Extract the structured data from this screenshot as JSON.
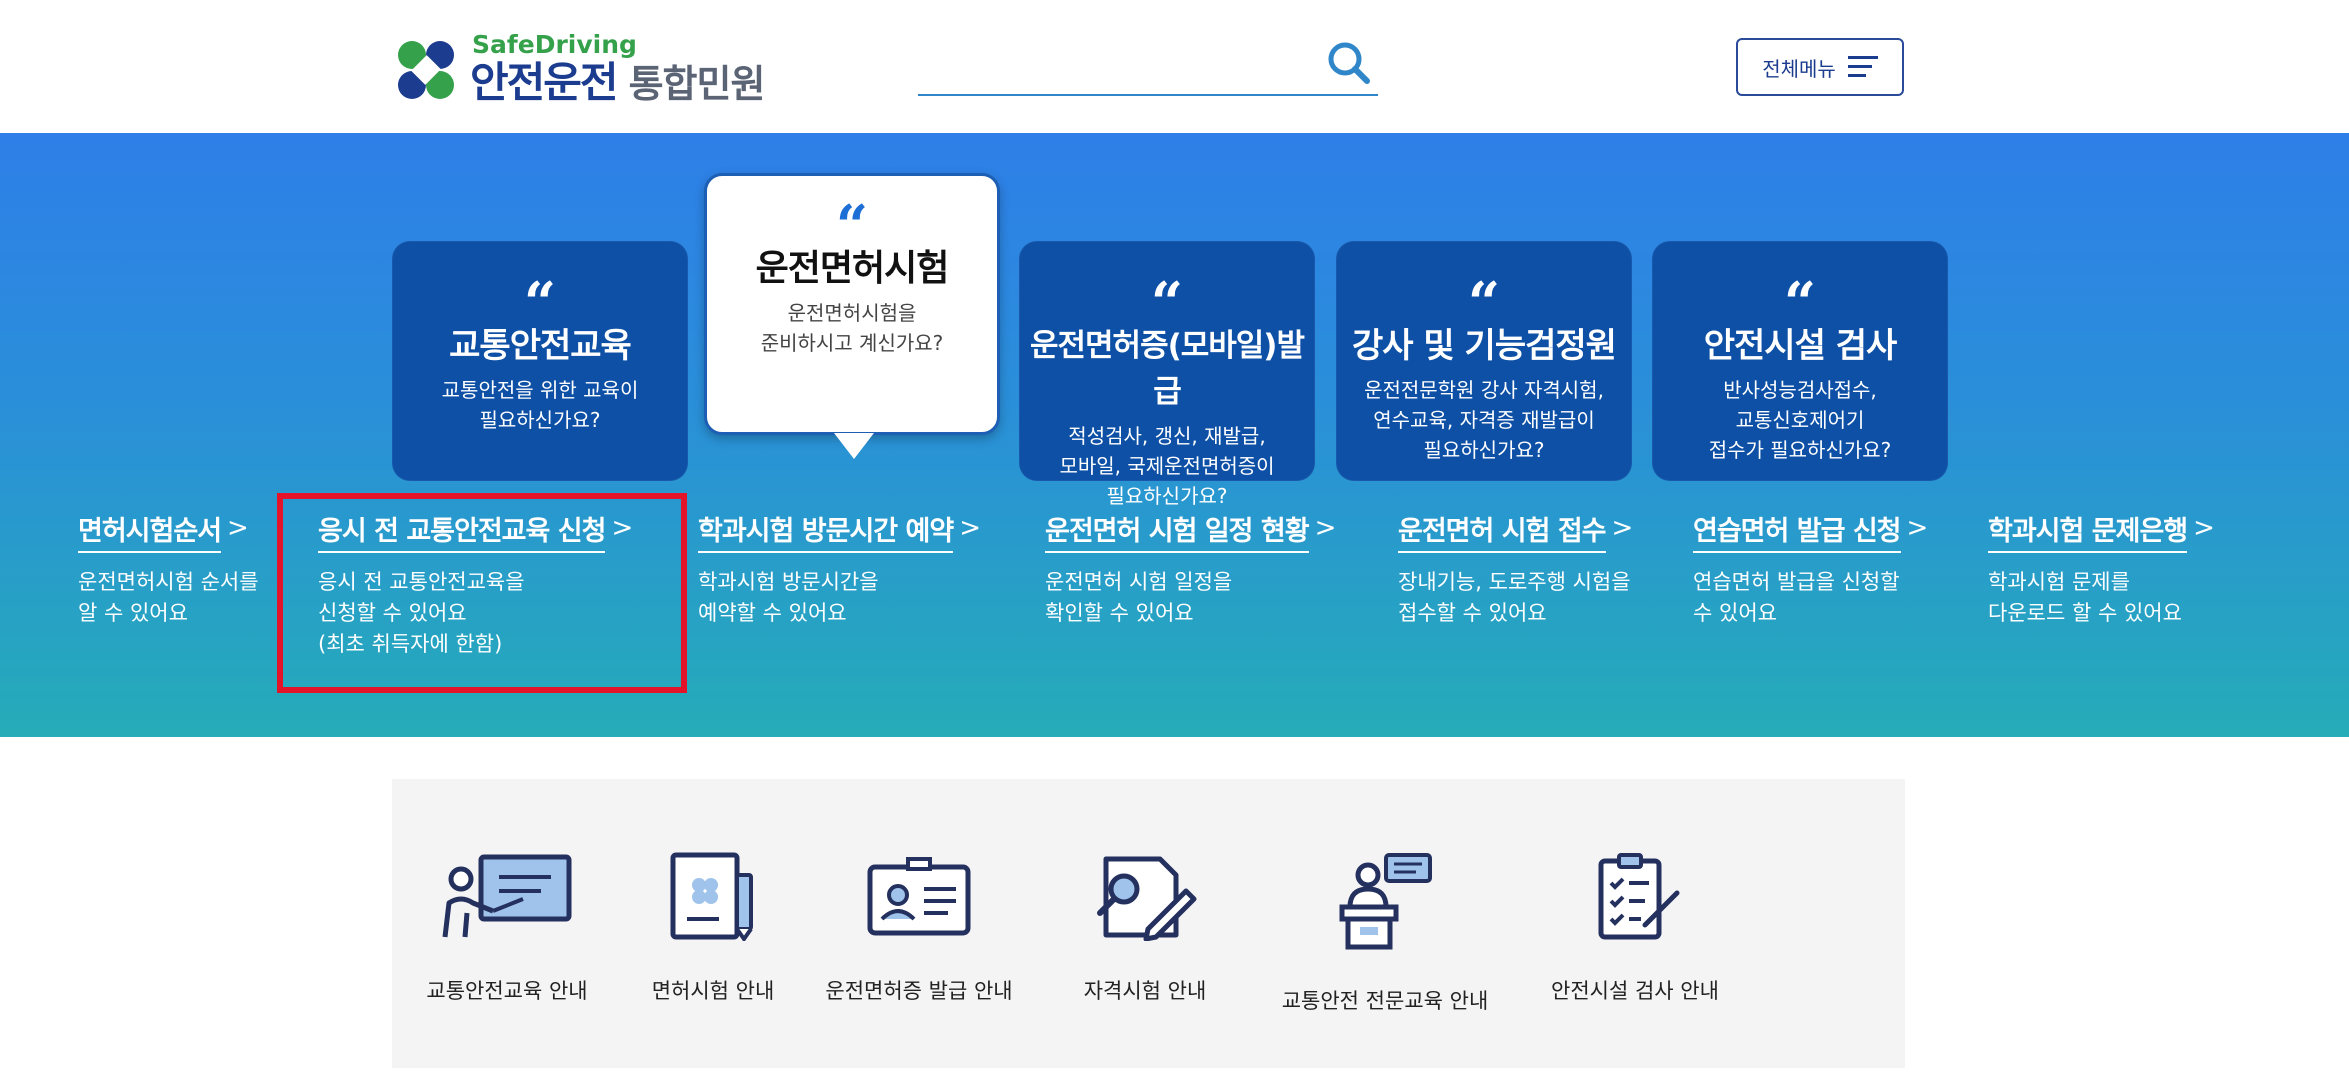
{
  "header": {
    "logo_sub": "SafeDriving",
    "logo_main": "안전운전",
    "logo_suffix": "통합민원",
    "search_placeholder": "",
    "menu_label": "전체메뉴"
  },
  "cards": [
    {
      "title": "교통안전교육",
      "desc": "교통안전을 위한 교육이\n필요하신가요?"
    },
    {
      "title": "운전면허시험",
      "desc": "운전면허시험을\n준비하시고 계신가요?",
      "active": true
    },
    {
      "title": "운전면허증(모바일)발급",
      "desc": "적성검사, 갱신, 재발급,\n모바일, 국제운전면허증이\n필요하신가요?"
    },
    {
      "title": "강사 및 기능검정원",
      "desc": "운전전문학원 강사 자격시험,\n연수교육, 자격증 재발급이\n필요하신가요?"
    },
    {
      "title": "안전시설 검사",
      "desc": "반사성능검사접수,\n교통신호제어기\n접수가 필요하신가요?"
    }
  ],
  "links": [
    {
      "title": "면허시험순서",
      "desc": "운전면허시험 순서를\n알 수 있어요"
    },
    {
      "title": "응시 전 교통안전교육 신청",
      "desc": "응시 전 교통안전교육을\n신청할 수 있어요\n(최초 취득자에 한함)"
    },
    {
      "title": "학과시험 방문시간 예약",
      "desc": "학과시험 방문시간을\n예약할 수 있어요"
    },
    {
      "title": "운전면허 시험 일정 현황",
      "desc": "운전면허 시험 일정을\n확인할 수 있어요"
    },
    {
      "title": "운전면허 시험 접수",
      "desc": "장내기능, 도로주행 시험을\n접수할 수 있어요"
    },
    {
      "title": "연습면허 발급 신청",
      "desc": "연습면허 발급을 신청할\n수 있어요"
    },
    {
      "title": "학과시험 문제은행",
      "desc": "학과시험 문제를\n다운로드 할 수 있어요"
    }
  ],
  "chevron": ">",
  "services": [
    {
      "label": "교통안전교육 안내",
      "icon": "presentation-icon"
    },
    {
      "label": "면허시험 안내",
      "icon": "license-document-icon"
    },
    {
      "label": "운전면허증 발급 안내",
      "icon": "id-card-icon"
    },
    {
      "label": "자격시험 안내",
      "icon": "certificate-search-icon"
    },
    {
      "label": "교통안전 전문교육 안내",
      "icon": "lecture-podium-icon"
    },
    {
      "label": "안전시설 검사 안내",
      "icon": "checklist-clipboard-icon"
    }
  ],
  "colors": {
    "brand_navy": "#1c3c8f",
    "brand_green": "#36a14b",
    "card_blue": "#0d50a6",
    "highlight_red": "#e3142a"
  }
}
